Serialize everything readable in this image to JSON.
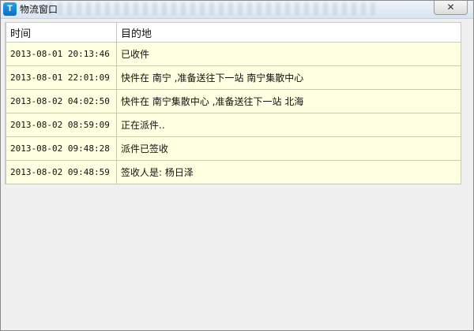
{
  "window": {
    "title": "物流窗口",
    "app_icon": "T",
    "close_symbol": "✕"
  },
  "table": {
    "columns": [
      "时间",
      "目的地"
    ],
    "rows": [
      {
        "time": "2013-08-01 20:13:46",
        "dest": "已收件"
      },
      {
        "time": "2013-08-01 22:01:09",
        "dest": "快件在 南宁 ,准备送往下一站 南宁集散中心"
      },
      {
        "time": "2013-08-02 04:02:50",
        "dest": "快件在 南宁集散中心 ,准备送往下一站 北海"
      },
      {
        "time": "2013-08-02 08:59:09",
        "dest": "正在派件.."
      },
      {
        "time": "2013-08-02 09:48:28",
        "dest": "派件已签收"
      },
      {
        "time": "2013-08-02 09:48:59",
        "dest": "签收人是: 杨日泽"
      }
    ]
  },
  "colors": {
    "row_background": "#ffffe1",
    "header_background": "#ffffff",
    "grid_line": "#c8c8c8",
    "window_background": "#f0f0f0"
  }
}
